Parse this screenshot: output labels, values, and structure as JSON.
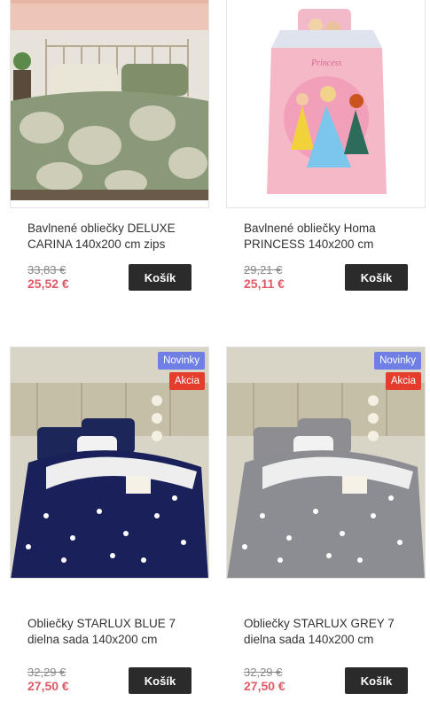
{
  "products": [
    {
      "title": "Bavlnené obliečky DELUXE CARINA 140x200 cm zips",
      "old_price": "33,83 €",
      "price": "25,52 €",
      "cart_label": "Košík",
      "badges": []
    },
    {
      "title": "Bavlnené obliečky Homa PRINCESS 140x200 cm",
      "old_price": "29,21 €",
      "price": "25,11 €",
      "cart_label": "Košík",
      "badges": []
    },
    {
      "title": "Obliečky STARLUX BLUE 7 dielna sada 140x200 cm",
      "old_price": "32,29 €",
      "price": "27,50 €",
      "cart_label": "Košík",
      "badges": [
        "Novinky",
        "Akcia"
      ]
    },
    {
      "title": "Obliečky STARLUX GREY 7 dielna sada 140x200 cm",
      "old_price": "32,29 €",
      "price": "27,50 €",
      "cart_label": "Košík",
      "badges": [
        "Novinky",
        "Akcia"
      ]
    }
  ],
  "colors": {
    "badge_new": "#6f7fe6",
    "badge_sale": "#e63c2c",
    "price": "#e05a66",
    "button": "#2b2b2b"
  }
}
